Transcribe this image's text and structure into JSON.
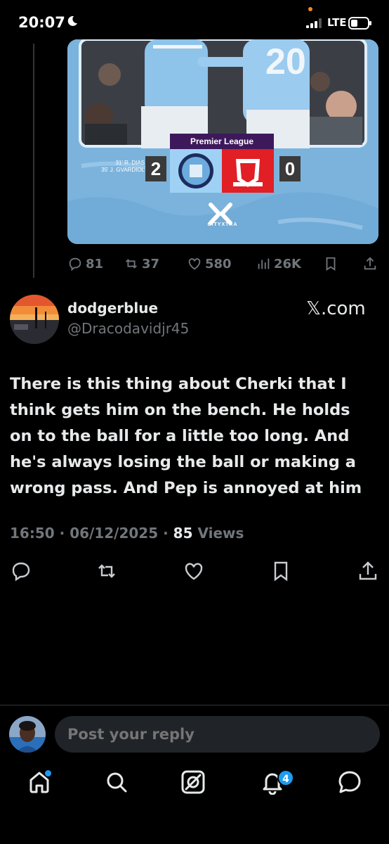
{
  "status_bar": {
    "time": "20:07",
    "network": "LTE",
    "icons": [
      "moon-icon",
      "signal-icon",
      "battery-icon"
    ]
  },
  "quoted_media": {
    "competition": "Premier League",
    "home_score": "2",
    "away_score": "0",
    "scorers": [
      "31' R. DIAS",
      "35' J. GVARDIOL"
    ],
    "watermark": "CITYXTRA",
    "jersey_number": "20"
  },
  "quoted_actions": {
    "replies": "81",
    "reposts": "37",
    "likes": "580",
    "views": "26K"
  },
  "post": {
    "display_name": "dodgerblue",
    "handle": "@Dracodavidjr45",
    "source_label": "𝕏.com",
    "text": "There is this thing about Cherki that I think gets him on the bench. He holds on to the ball for a little too long. And he's always losing the ball or making a wrong pass. And Pep is annoyed at him",
    "time": "16:50",
    "date": "06/12/2025",
    "views_count": "85",
    "views_label": "Views"
  },
  "reply": {
    "placeholder": "Post your reply"
  },
  "nav": {
    "items": [
      "home-icon",
      "search-icon",
      "grok-icon",
      "notifications-icon",
      "messages-icon"
    ],
    "notifications_badge": "4"
  },
  "colors": {
    "background": "#000000",
    "text_primary": "#e7e9ea",
    "text_secondary": "#71767b",
    "accent": "#1d9bf0",
    "city_blue": "#7fb6df"
  }
}
